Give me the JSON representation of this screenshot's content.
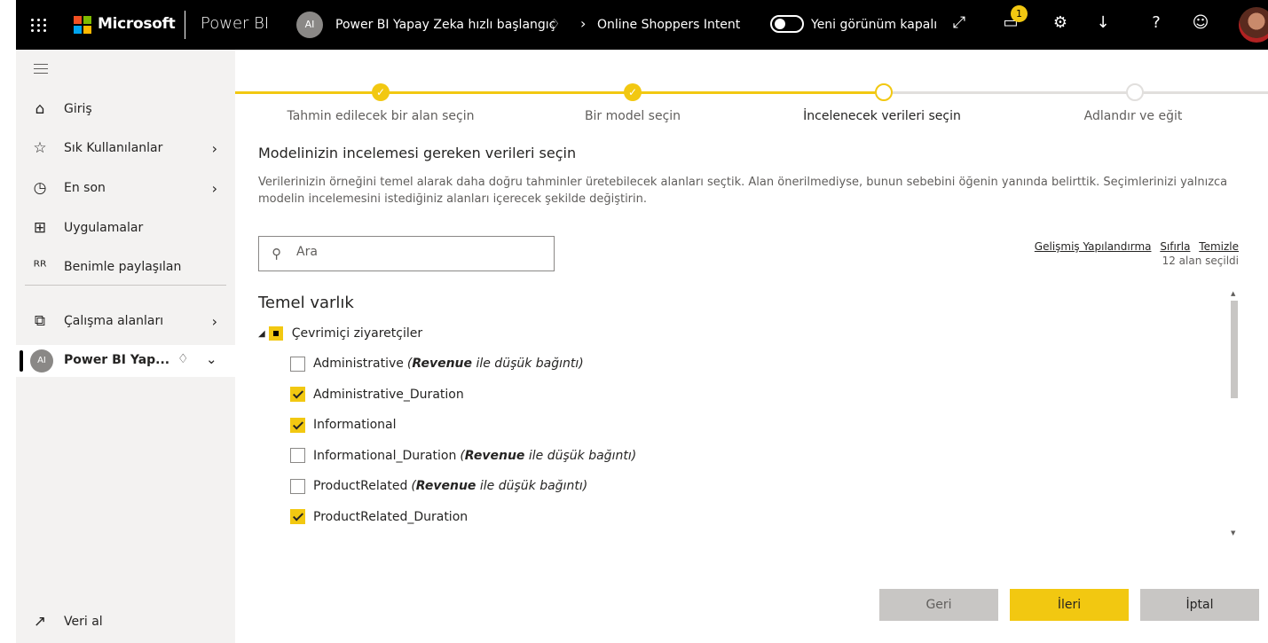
{
  "topbar": {
    "brand": "Microsoft",
    "app": "Power BI",
    "workspace_avatar": "AI",
    "workspace_name": "Power BI Yapay Zeka hızlı başlangıç",
    "breadcrumb_item": "Online Shoppers Intent",
    "toggle_label": "Yeni görünüm kapalı",
    "notification_count": "1",
    "icons": [
      "waffle-icon",
      "diamond-icon",
      "chevron-right-icon",
      "expand-icon",
      "notification-icon",
      "gear-icon",
      "download-icon",
      "help-icon",
      "smiley-icon"
    ]
  },
  "sidebar": {
    "items": [
      {
        "label": "Giriş",
        "icon": "home-icon"
      },
      {
        "label": "Sık Kullanılanlar",
        "icon": "star-icon"
      },
      {
        "label": "En son",
        "icon": "clock-icon"
      },
      {
        "label": "Uygulamalar",
        "icon": "apps-icon"
      },
      {
        "label": "Benimle paylaşılan",
        "icon": "shared-icon"
      },
      {
        "label": "Çalışma alanları",
        "icon": "workspaces-icon"
      }
    ],
    "active_workspace": {
      "label": "Power BI Yap...",
      "avatar": "AI"
    },
    "bottom": {
      "label": "Veri al",
      "icon": "get-data-arrow-icon"
    }
  },
  "stepper": {
    "steps": [
      {
        "label": "Tahmin edilecek bir alan seçin",
        "state": "done"
      },
      {
        "label": "Bir model seçin",
        "state": "done"
      },
      {
        "label": "İncelenecek verileri seçin",
        "state": "current"
      },
      {
        "label": "Adlandır ve eğit",
        "state": "todo"
      }
    ],
    "accent": "#f2c811"
  },
  "main": {
    "title": "Modelinizin incelemesi gereken verileri seçin",
    "description": "Verilerinizin örneğini temel alarak daha doğru tahminler üretebilecek alanları seçtik. Alan önerilmediyse, bunun sebebini öğenin yanında belirttik. Seçimlerinizi yalnızca modelin incelemesini istediğiniz alanları içerecek şekilde değiştirin.",
    "search_placeholder": "Ara",
    "links": {
      "advanced": "Gelişmiş Yapılandırma",
      "reset": "Sıfırla",
      "clear": "Temizle"
    },
    "selected_count": "12 alan seçildi",
    "entity_title": "Temel varlık",
    "entity_name": "Çevrimiçi ziyaretçiler",
    "fields": [
      {
        "name": "Administrative",
        "checked": false,
        "note_bold": "Revenue",
        "note_rest": " ile düşük bağıntı)",
        "note_open": "("
      },
      {
        "name": "Administrative_Duration",
        "checked": true
      },
      {
        "name": "Informational",
        "checked": true
      },
      {
        "name": "Informational_Duration",
        "checked": false,
        "note_bold": "Revenue",
        "note_rest": " ile düşük bağıntı)",
        "note_open": "("
      },
      {
        "name": "ProductRelated",
        "checked": false,
        "note_bold": "Revenue",
        "note_rest": " ile düşük bağıntı)",
        "note_open": "("
      },
      {
        "name": "ProductRelated_Duration",
        "checked": true
      }
    ]
  },
  "buttons": {
    "back": "Geri",
    "next": "İleri",
    "cancel": "İptal"
  }
}
